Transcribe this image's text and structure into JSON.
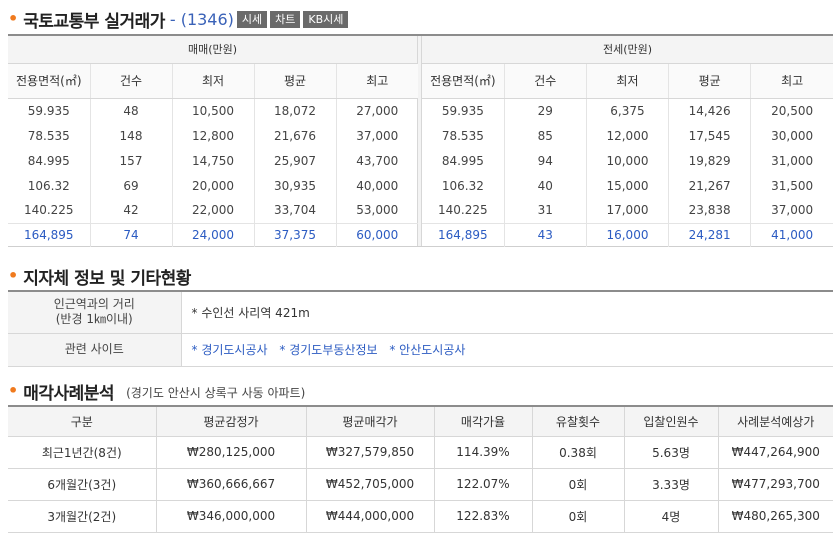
{
  "trade_section": {
    "title": "국토교통부 실거래가",
    "dash": "-",
    "count": "(1346)",
    "tags": [
      "시세",
      "차트",
      "KB시세"
    ]
  },
  "sale": {
    "header": "매매(만원)",
    "columns": [
      "전용면적(㎡)",
      "건수",
      "최저",
      "평균",
      "최고"
    ],
    "rows": [
      [
        "59.935",
        "48",
        "10,500",
        "18,072",
        "27,000"
      ],
      [
        "78.535",
        "148",
        "12,800",
        "21,676",
        "37,000"
      ],
      [
        "84.995",
        "157",
        "14,750",
        "25,907",
        "43,700"
      ],
      [
        "106.32",
        "69",
        "20,000",
        "30,935",
        "40,000"
      ],
      [
        "140.225",
        "42",
        "22,000",
        "33,704",
        "53,000"
      ]
    ],
    "total": [
      "164,895",
      "74",
      "24,000",
      "37,375",
      "60,000"
    ]
  },
  "lease": {
    "header": "전세(만원)",
    "columns": [
      "전용면적(㎡)",
      "건수",
      "최저",
      "평균",
      "최고"
    ],
    "rows": [
      [
        "59.935",
        "29",
        "6,375",
        "14,426",
        "20,500"
      ],
      [
        "78.535",
        "85",
        "12,000",
        "17,545",
        "30,000"
      ],
      [
        "84.995",
        "94",
        "10,000",
        "19,829",
        "31,000"
      ],
      [
        "106.32",
        "40",
        "15,000",
        "21,267",
        "31,500"
      ],
      [
        "140.225",
        "31",
        "17,000",
        "23,838",
        "37,000"
      ]
    ],
    "total": [
      "164,895",
      "43",
      "16,000",
      "24,281",
      "41,000"
    ]
  },
  "local_section": {
    "title": "지자체 정보 및 기타현황",
    "station_label_1": "인근역과의 거리",
    "station_label_2": "(반경 1㎞이내)",
    "station_value": "* 수인선 사리역 421m",
    "sites_label": "관련 사이트",
    "sites": [
      "* 경기도시공사",
      "* 경기도부동산정보",
      "* 안산도시공사"
    ]
  },
  "auction_section": {
    "title": "매각사례분석",
    "desc": "(경기도 안산시 상록구 사동 아파트)",
    "columns": [
      "구분",
      "평균감정가",
      "평균매각가",
      "매각가율",
      "유찰횟수",
      "입찰인원수",
      "사례분석예상가"
    ],
    "rows": [
      [
        "최근1년간(8건)",
        "₩280,125,000",
        "₩327,579,850",
        "114.39%",
        "0.38회",
        "5.63명",
        "₩447,264,900"
      ],
      [
        "6개월간(3건)",
        "₩360,666,667",
        "₩452,705,000",
        "122.07%",
        "0회",
        "3.33명",
        "₩477,293,700"
      ],
      [
        "3개월간(2건)",
        "₩346,000,000",
        "₩444,000,000",
        "122.83%",
        "0회",
        "4명",
        "₩480,265,300"
      ]
    ]
  },
  "colors": {
    "accent_bullet": "#f07a1e",
    "link_blue": "#2b5bc2",
    "tag_bg": "#6a6a6a"
  }
}
